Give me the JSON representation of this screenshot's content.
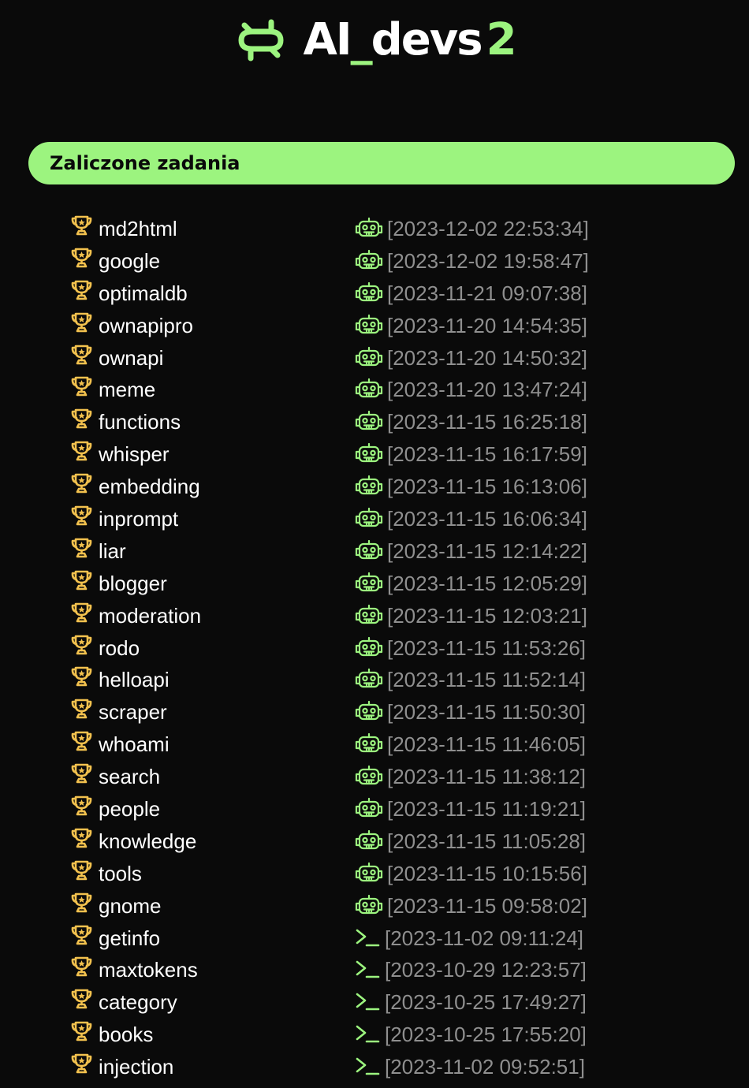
{
  "brand": {
    "name_prefix": "AI",
    "name_underscore": "_",
    "name_suffix": "devs",
    "version": "2",
    "accent_color": "#9cf47f",
    "icon": "logo-loop-icon"
  },
  "section": {
    "title": "Zaliczone zadania"
  },
  "colors": {
    "background": "#0a0a0a",
    "trophy": "#f2c14e",
    "timestamp": "#8f8f8f"
  },
  "tasks": [
    {
      "name": "md2html",
      "time": "[2023-12-02 22:53:34]",
      "type": "robot"
    },
    {
      "name": "google",
      "time": "[2023-12-02 19:58:47]",
      "type": "robot"
    },
    {
      "name": "optimaldb",
      "time": "[2023-11-21 09:07:38]",
      "type": "robot"
    },
    {
      "name": "ownapipro",
      "time": "[2023-11-20 14:54:35]",
      "type": "robot"
    },
    {
      "name": "ownapi",
      "time": "[2023-11-20 14:50:32]",
      "type": "robot"
    },
    {
      "name": "meme",
      "time": "[2023-11-20 13:47:24]",
      "type": "robot"
    },
    {
      "name": "functions",
      "time": "[2023-11-15 16:25:18]",
      "type": "robot"
    },
    {
      "name": "whisper",
      "time": "[2023-11-15 16:17:59]",
      "type": "robot"
    },
    {
      "name": "embedding",
      "time": "[2023-11-15 16:13:06]",
      "type": "robot"
    },
    {
      "name": "inprompt",
      "time": "[2023-11-15 16:06:34]",
      "type": "robot"
    },
    {
      "name": "liar",
      "time": "[2023-11-15 12:14:22]",
      "type": "robot"
    },
    {
      "name": "blogger",
      "time": "[2023-11-15 12:05:29]",
      "type": "robot"
    },
    {
      "name": "moderation",
      "time": "[2023-11-15 12:03:21]",
      "type": "robot"
    },
    {
      "name": "rodo",
      "time": "[2023-11-15 11:53:26]",
      "type": "robot"
    },
    {
      "name": "helloapi",
      "time": "[2023-11-15 11:52:14]",
      "type": "robot"
    },
    {
      "name": "scraper",
      "time": "[2023-11-15 11:50:30]",
      "type": "robot"
    },
    {
      "name": "whoami",
      "time": "[2023-11-15 11:46:05]",
      "type": "robot"
    },
    {
      "name": "search",
      "time": "[2023-11-15 11:38:12]",
      "type": "robot"
    },
    {
      "name": "people",
      "time": "[2023-11-15 11:19:21]",
      "type": "robot"
    },
    {
      "name": "knowledge",
      "time": "[2023-11-15 11:05:28]",
      "type": "robot"
    },
    {
      "name": "tools",
      "time": "[2023-11-15 10:15:56]",
      "type": "robot"
    },
    {
      "name": "gnome",
      "time": "[2023-11-15 09:58:02]",
      "type": "robot"
    },
    {
      "name": "getinfo",
      "time": "[2023-11-02 09:11:24]",
      "type": "terminal"
    },
    {
      "name": "maxtokens",
      "time": "[2023-10-29 12:23:57]",
      "type": "terminal"
    },
    {
      "name": "category",
      "time": "[2023-10-25 17:49:27]",
      "type": "terminal"
    },
    {
      "name": "books",
      "time": "[2023-10-25 17:55:20]",
      "type": "terminal"
    },
    {
      "name": "injection",
      "time": "[2023-11-02 09:52:51]",
      "type": "terminal"
    }
  ]
}
